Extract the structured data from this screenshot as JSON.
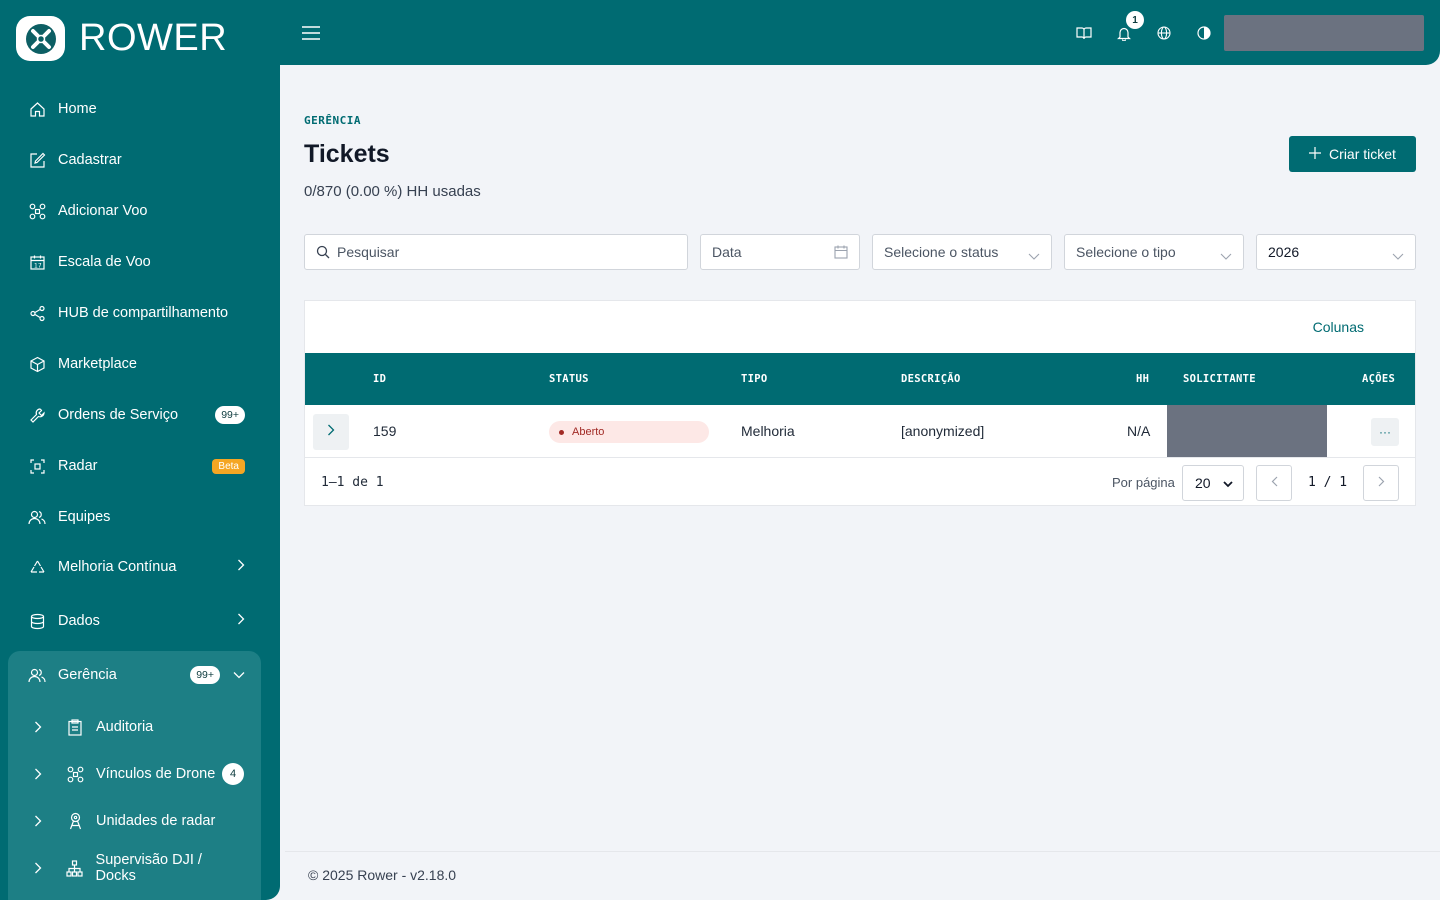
{
  "brand": {
    "name": "ROWER"
  },
  "header": {
    "notifications_count": "1"
  },
  "sidebar": {
    "items": [
      {
        "label": "Home",
        "icon": "home-icon"
      },
      {
        "label": "Cadastrar",
        "icon": "edit-icon"
      },
      {
        "label": "Adicionar Voo",
        "icon": "drone-icon"
      },
      {
        "label": "Escala de Voo",
        "icon": "calendar-icon"
      },
      {
        "label": "HUB de compartilhamento",
        "icon": "share-icon"
      },
      {
        "label": "Marketplace",
        "icon": "box-icon"
      },
      {
        "label": "Ordens de Serviço",
        "icon": "wrench-icon",
        "badge": "99+"
      },
      {
        "label": "Radar",
        "icon": "radar-icon",
        "tag": "Beta"
      },
      {
        "label": "Equipes",
        "icon": "users-icon"
      },
      {
        "label": "Melhoria Contínua",
        "icon": "recycle-icon"
      },
      {
        "label": "Dados",
        "icon": "database-icon"
      }
    ],
    "group": {
      "label": "Gerência",
      "badge": "99+",
      "children": [
        {
          "label": "Auditoria",
          "icon": "clipboard-icon"
        },
        {
          "label": "Vínculos de Drone",
          "icon": "drone-icon",
          "badge": "4"
        },
        {
          "label": "Unidades de radar",
          "icon": "antenna-icon"
        },
        {
          "label": "Supervisão DJI / Docks",
          "icon": "network-icon"
        }
      ]
    }
  },
  "page": {
    "eyebrow": "GERÊNCIA",
    "title": "Tickets",
    "usage": "0/870 (0.00 %) HH usadas",
    "create_label": "Criar ticket"
  },
  "filters": {
    "search_placeholder": "Pesquisar",
    "date_placeholder": "Data",
    "status_placeholder": "Selecione o status",
    "type_placeholder": "Selecione o tipo",
    "year": "2026"
  },
  "table": {
    "columns_button": "Colunas",
    "headers": [
      "ID",
      "STATUS",
      "TIPO",
      "DESCRIÇÃO",
      "HH",
      "SOLICITANTE",
      "AÇÕES"
    ],
    "rows": [
      {
        "id": "159",
        "status": "Aberto",
        "type": "Melhoria",
        "description": "[anonymized]",
        "hh": "N/A",
        "actions": "···"
      }
    ],
    "count": "1–1 de 1",
    "per_page_label": "Por página",
    "per_page": "20",
    "page_indicator": "1 / 1"
  },
  "footer": {
    "text": "© 2025 Rower - v2.18.0"
  },
  "colors": {
    "primary": "#006b72",
    "group_bg": "#1d7f85",
    "beta": "#f5a623",
    "status_bg": "#fde8e6",
    "status_fg": "#a12a25"
  }
}
